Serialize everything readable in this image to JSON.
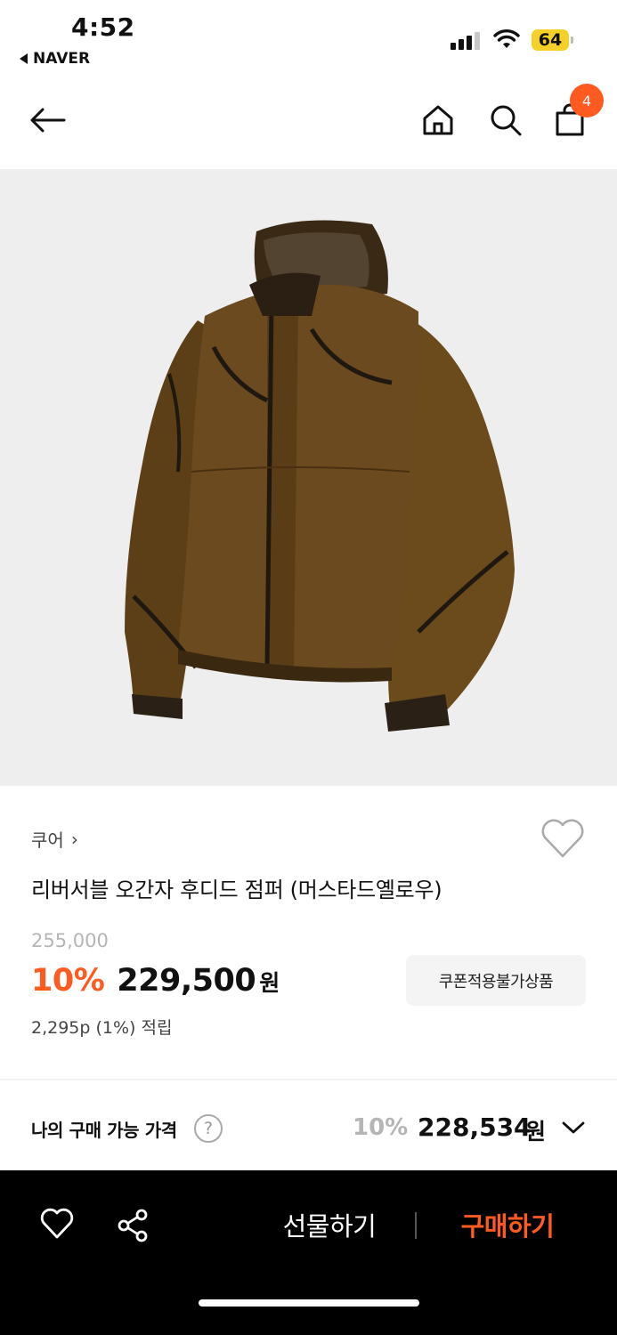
{
  "status": {
    "time": "4:52",
    "back_app": "NAVER",
    "battery": "64"
  },
  "header": {
    "cart_count": "4"
  },
  "product": {
    "brand": "쿠어",
    "brand_chevron": "›",
    "title": "리버서블 오간자 후디드 점퍼 (머스타드옐로우)",
    "original_price": "255,000",
    "discount": "10%",
    "sale_price": "229,500",
    "currency": "원",
    "coupon_notice": "쿠폰적용불가상품",
    "points": "2,295p (1%) 적립"
  },
  "my_price": {
    "label": "나의 구매 가능 가격",
    "help": "?",
    "discount": "10%",
    "price": "228,534",
    "currency": "원"
  },
  "bottom": {
    "gift": "선물하기",
    "buy": "구매하기"
  },
  "colors": {
    "accent": "#ff5a1f",
    "battery": "#f5d027",
    "hero_bg": "#eeeeee",
    "jacket": "#6b4a1f"
  }
}
